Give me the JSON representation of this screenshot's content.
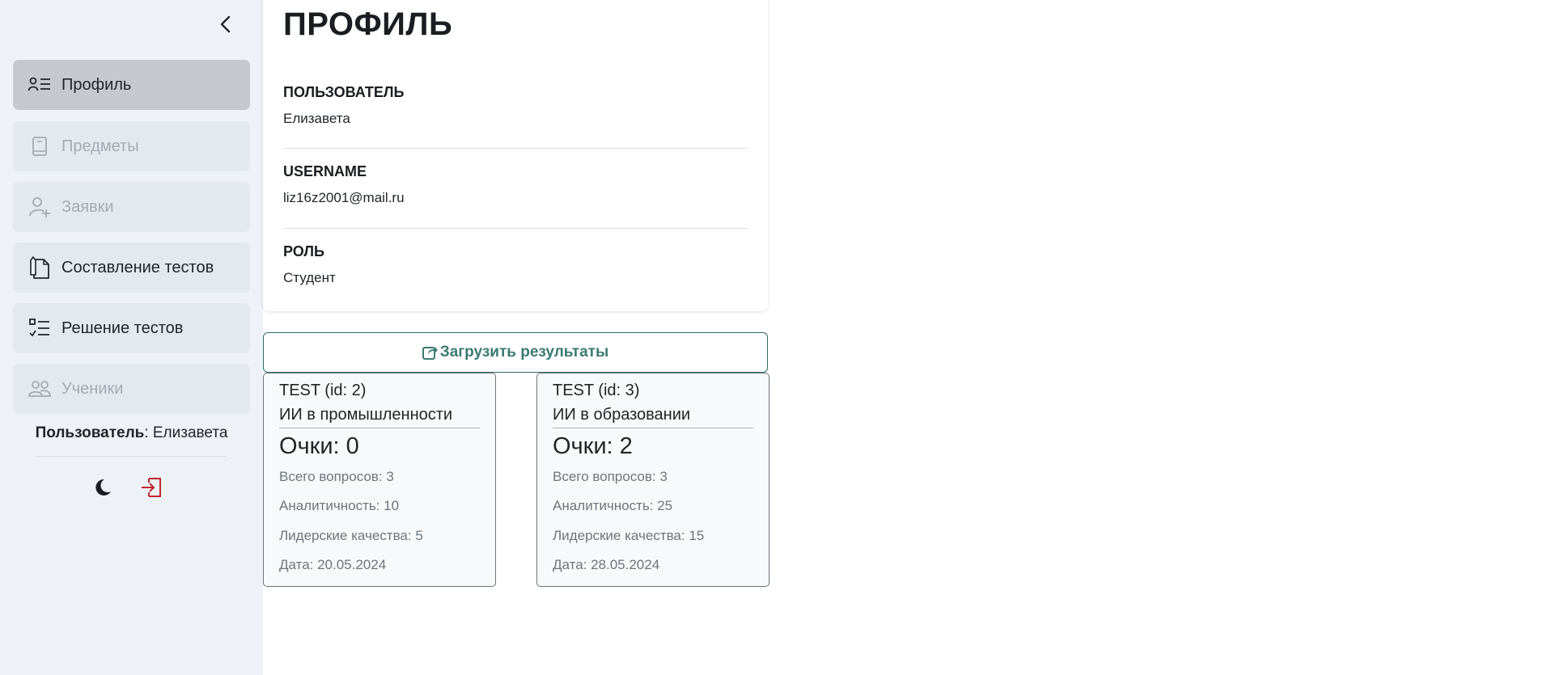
{
  "sidebar": {
    "items": [
      {
        "label": "Профиль",
        "icon": "profile-list-icon",
        "state": "active"
      },
      {
        "label": "Предметы",
        "icon": "book-icon",
        "state": "disabled"
      },
      {
        "label": "Заявки",
        "icon": "user-plus-icon",
        "state": "disabled"
      },
      {
        "label": "Составление тестов",
        "icon": "documents-pen-icon",
        "state": "normal"
      },
      {
        "label": "Решение тестов",
        "icon": "checklist-icon",
        "state": "normal"
      },
      {
        "label": "Ученики",
        "icon": "people-icon",
        "state": "disabled"
      }
    ],
    "user_label": "Пользователь",
    "user_name": ": Елизавета"
  },
  "profile": {
    "title": "ПРОФИЛЬ",
    "fields": [
      {
        "label": "ПОЛЬЗОВАТЕЛЬ",
        "value": "Елизавета"
      },
      {
        "label": "USERNAME",
        "value": "liz16z2001@mail.ru"
      },
      {
        "label": "РОЛЬ",
        "value": "Студент"
      }
    ]
  },
  "upload_button": {
    "label": "Загрузить результаты"
  },
  "results": [
    {
      "id_label": "TEST (id: 2)",
      "name": "ИИ в промышленности",
      "score": "Очки: 0",
      "total_questions": "Всего вопросов: 3",
      "analytics": "Аналитичность: 10",
      "leadership": "Лидерские качества: 5",
      "date": "Дата: 20.05.2024"
    },
    {
      "id_label": "TEST (id: 3)",
      "name": "ИИ в образовании",
      "score": "Очки: 2",
      "total_questions": "Всего вопросов: 3",
      "analytics": "Аналитичность: 25",
      "leadership": "Лидерские качества: 15",
      "date": "Дата: 28.05.2024"
    }
  ],
  "colors": {
    "sidebar_bg": "#eef2f6",
    "nav_active": "#c5c9ce",
    "accent_teal": "#3b7b72",
    "logout_red": "#c0262d"
  }
}
